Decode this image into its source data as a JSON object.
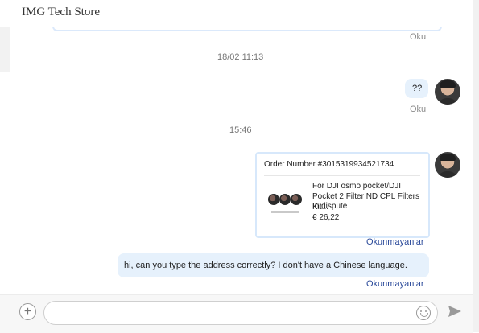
{
  "header": {
    "title": "IMG Tech Store"
  },
  "messages": {
    "prev_status": "Oku",
    "timestamp_1": "18/02 11:13",
    "msg_1": {
      "text": "??",
      "status": "Oku"
    },
    "timestamp_2": "15:46",
    "order_card": {
      "order_number": "Order Number #3015319934521734",
      "product_name": "For DJI osmo pocket/DJI Pocket 2 Filter ND CPL Filters Kit...",
      "status": "In dispute",
      "price": "€ 26,22",
      "read_status": "Okunmayanlar"
    },
    "msg_2": {
      "text": "hi, can you type the address correctly? I don't have a Chinese language.",
      "status": "Okunmayanlar"
    }
  },
  "composer": {
    "input_value": "",
    "placeholder": ""
  },
  "icons": {
    "add": "plus-icon",
    "emoji": "emoji-icon",
    "send": "send-icon",
    "avatar": "avatar-icon"
  },
  "colors": {
    "bubble": "#e6f1fc",
    "link": "#2b4a9a",
    "card_border": "#d7e8fb"
  }
}
